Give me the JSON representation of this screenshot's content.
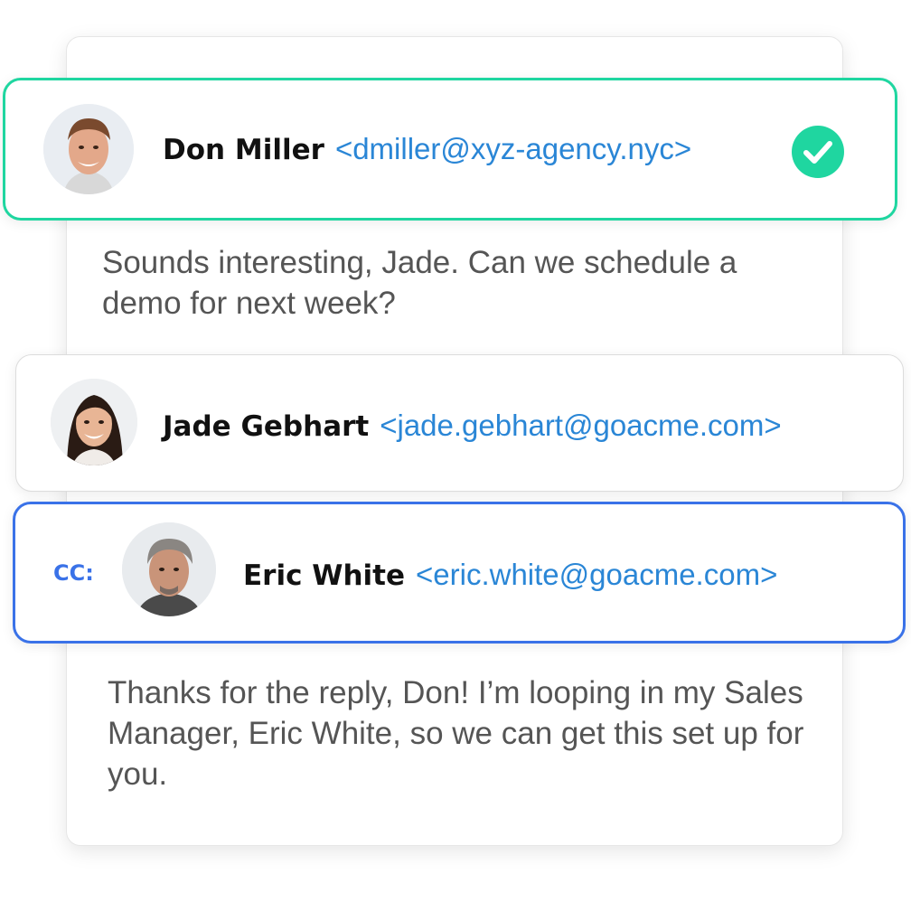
{
  "thread": {
    "messages": [
      {
        "sender_name": "Don Miller",
        "sender_email": "<dmiller@xyz-agency.nyc>",
        "verified_icon": "check-circle-icon",
        "body": "Sounds interesting, Jade. Can we schedule a demo for next week?"
      },
      {
        "sender_name": "Jade Gebhart",
        "sender_email": "<jade.gebhart@goacme.com>",
        "cc_label": "CC:",
        "cc_name": "Eric White",
        "cc_email": "<eric.white@goacme.com>",
        "body": "Thanks for the reply, Don! I’m looping in my Sales Manager, Eric White, so we can get this set up for you."
      }
    ]
  },
  "colors": {
    "verified_border": "#1fd6a0",
    "cc_border": "#3a72e8",
    "email_link": "#2a86d6",
    "body_text": "#555555"
  }
}
